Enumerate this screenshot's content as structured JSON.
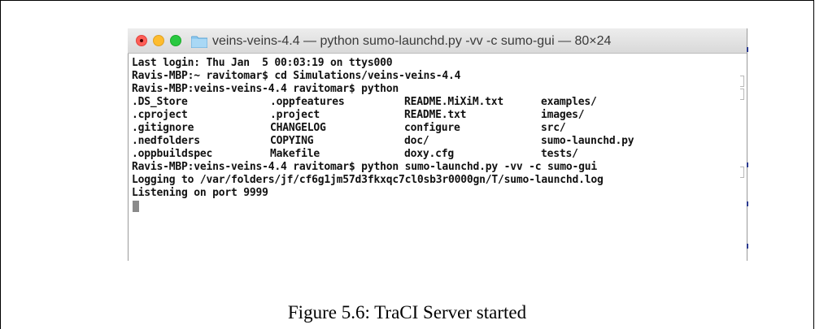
{
  "window": {
    "title": "veins-veins-4.4 — python sumo-launchd.py -vv -c sumo-gui — 80×24",
    "icon": "folder-icon",
    "buttons": [
      "close-button",
      "minimize-button",
      "zoom-button"
    ]
  },
  "terminal": {
    "lines": [
      "Last login: Thu Jan  5 00:03:19 on ttys000",
      "Ravis-MBP:~ ravitomar$ cd Simulations/veins-veins-4.4",
      "Ravis-MBP:veins-veins-4.4 ravitomar$ python"
    ],
    "listing": [
      [
        ".DS_Store",
        ".oppfeatures",
        "README.MiXiM.txt",
        "examples/"
      ],
      [
        ".cproject",
        ".project",
        "README.txt",
        "images/"
      ],
      [
        ".gitignore",
        "CHANGELOG",
        "configure",
        "src/"
      ],
      [
        ".nedfolders",
        "COPYING",
        "doc/",
        "sumo-launchd.py"
      ],
      [
        ".oppbuildspec",
        "Makefile",
        "doxy.cfg",
        "tests/"
      ]
    ],
    "after": [
      "Ravis-MBP:veins-veins-4.4 ravitomar$ python sumo-launchd.py -vv -c sumo-gui",
      "Logging to /var/folders/jf/cf6g1jm57d3fkxqc7cl0sb3r0000gn/T/sumo-launchd.log",
      "Listening on port 9999"
    ]
  },
  "caption": "Figure 5.6: TraCI Server started",
  "colors": {
    "close": "#ff5f57",
    "minimize": "#febc2e",
    "zoom": "#28c840",
    "folder": "#8ec9ef"
  }
}
